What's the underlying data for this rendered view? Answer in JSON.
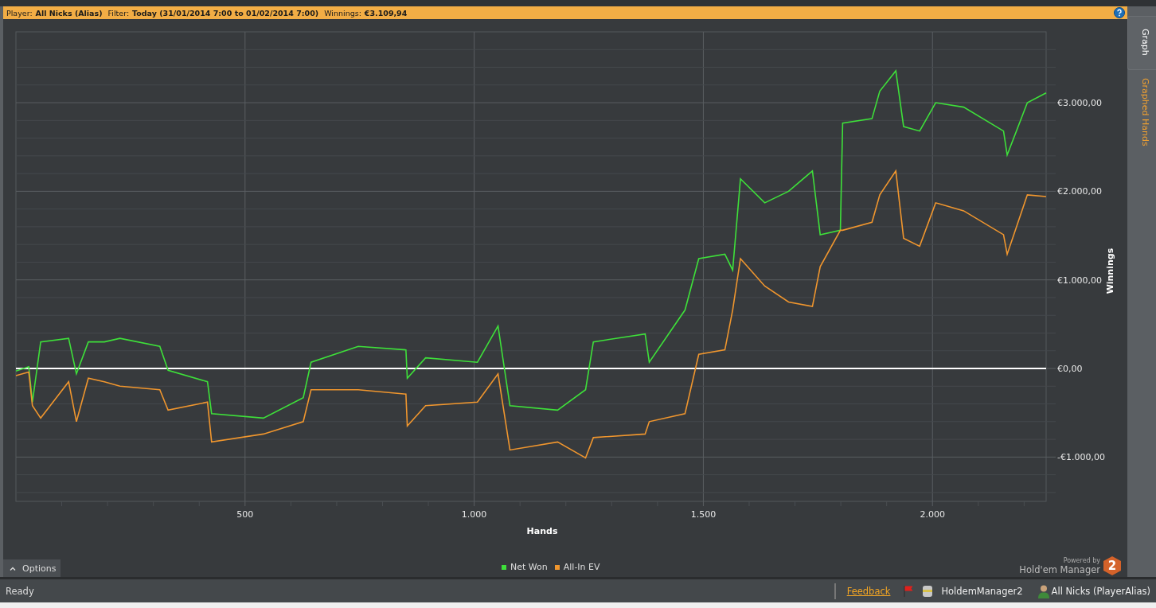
{
  "header": {
    "player_label": "Player:",
    "player": "All Nicks (Alias)",
    "filter_label": "Filter:",
    "filter": "Today (31/01/2014 7:00 to 01/02/2014 7:00)",
    "winnings_label": "Winnings:",
    "winnings": "€3.109,94"
  },
  "side_tabs": [
    {
      "label": "Graph",
      "selected": true
    },
    {
      "label": "Graphed Hands",
      "selected": false
    }
  ],
  "chart_data": {
    "type": "line",
    "grid": true,
    "xlabel": "Hands",
    "ylabel": "Winnings",
    "xlim": [
      0,
      2248
    ],
    "ylim": [
      -1500,
      3800
    ],
    "xticks": [
      {
        "value": 500,
        "label": "500"
      },
      {
        "value": 1000,
        "label": "1.000"
      },
      {
        "value": 1500,
        "label": "1.500"
      },
      {
        "value": 2000,
        "label": "2.000"
      }
    ],
    "yticks": [
      {
        "value": -1000,
        "label": "-€1.000,00"
      },
      {
        "value": 0,
        "label": "€0,00"
      },
      {
        "value": 1000,
        "label": "€1.000,00"
      },
      {
        "value": 2000,
        "label": "€2.000,00"
      },
      {
        "value": 3000,
        "label": "€3.000,00"
      }
    ],
    "x": [
      0,
      28,
      36,
      54,
      115,
      132,
      158,
      193,
      227,
      314,
      332,
      418,
      427,
      540,
      627,
      644,
      747,
      851,
      854,
      894,
      1007,
      1052,
      1078,
      1182,
      1243,
      1260,
      1373,
      1382,
      1460,
      1490,
      1547,
      1564,
      1581,
      1634,
      1686,
      1738,
      1755,
      1799,
      1804,
      1868,
      1885,
      1920,
      1937,
      1972,
      2007,
      2068,
      2155,
      2163,
      2207,
      2248
    ],
    "series": [
      {
        "name": "Net Won",
        "color": "#3ee03a",
        "values": [
          -30,
          20,
          -380,
          300,
          340,
          -60,
          300,
          300,
          340,
          250,
          -20,
          -150,
          -510,
          -560,
          -330,
          70,
          250,
          210,
          -110,
          120,
          70,
          480,
          -420,
          -470,
          -240,
          300,
          390,
          70,
          660,
          1240,
          1290,
          1110,
          2140,
          1870,
          2000,
          2230,
          1510,
          1560,
          2770,
          2820,
          3130,
          3360,
          2730,
          2680,
          3000,
          2950,
          2680,
          2410,
          3000,
          3110
        ]
      },
      {
        "name": "All-In EV",
        "color": "#f0962e",
        "values": [
          -80,
          -40,
          -420,
          -560,
          -150,
          -600,
          -110,
          -150,
          -200,
          -240,
          -470,
          -380,
          -830,
          -740,
          -600,
          -240,
          -240,
          -290,
          -650,
          -420,
          -380,
          -60,
          -920,
          -830,
          -1010,
          -780,
          -740,
          -600,
          -510,
          160,
          210,
          660,
          1240,
          930,
          750,
          700,
          1150,
          1560,
          1560,
          1650,
          1960,
          2230,
          1470,
          1380,
          1870,
          1780,
          1510,
          1290,
          1960,
          1940
        ]
      }
    ]
  },
  "options_button": "Options",
  "branding": {
    "powered_by": "Powered by",
    "product": "Hold'em Manager",
    "logo_mark": "2"
  },
  "status_bar": {
    "status": "Ready",
    "feedback_link": "Feedback",
    "database": "HoldemManager2",
    "player": "All Nicks (PlayerAlias)"
  }
}
